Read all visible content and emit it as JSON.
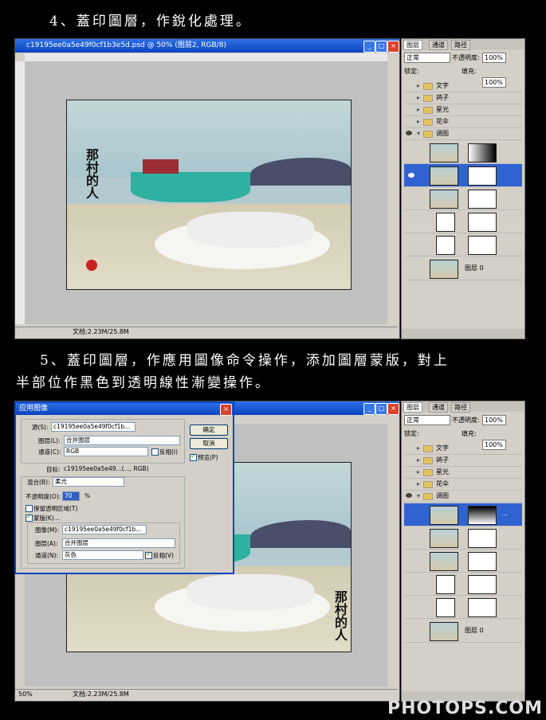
{
  "steps": {
    "step4": "4、蓋印圖層，作銳化處理。",
    "step5_line1": "5、蓋印圖層，作應用圖像命令操作，添加圖層蒙版，對上",
    "step5_line2": "半部位作黑色到透明線性漸變操作。"
  },
  "doc_window": {
    "title": "c19195ee0a5e49f0cf1b3e5d.psd @ 50% (图层2, RGB/8)",
    "status_zoom": "50%",
    "status_doc": "文档:2.23M/25.8M",
    "btn_min": "_",
    "btn_max": "□",
    "btn_close": "×"
  },
  "layers_panel": {
    "tabs": [
      "图层",
      "通道",
      "路径"
    ],
    "blend_mode": "正常",
    "opacity_label": "不透明度:",
    "opacity_value": "100%",
    "lock_label": "锁定:",
    "fill_label": "填充:",
    "fill_value": "100%",
    "groups": [
      "文字",
      "鸽子",
      "星光",
      "花伞",
      "调图"
    ],
    "base_layer": "图层 0",
    "ellipsis": "..."
  },
  "apply_image_dialog": {
    "title": "应用图像",
    "source_label": "源(S):",
    "source_value": "c19195ee0a5e49f0cf1b...",
    "layer_label": "图层(L):",
    "layer_value": "合并图层",
    "channel_label": "通道(C):",
    "channel_value": "RGB",
    "invert_label": "反相(I)",
    "target_label": "目标:",
    "target_value": "c19195ee0a5e49...(..., RGB)",
    "blending_label": "混合(B):",
    "blending_value": "柔光",
    "opacity_label": "不透明度(O):",
    "opacity_value": "70",
    "opacity_unit": "%",
    "preserve_label": "保留透明区域(T)",
    "mask_label": "蒙版(K)...",
    "image_label": "图像(M):",
    "image_value": "c19195ee0a5e49f0cf1b...",
    "mlayer_label": "图层(A):",
    "mlayer_value": "合并图层",
    "mchannel_label": "通道(N):",
    "mchannel_value": "灰色",
    "minvert_label": "反相(V)",
    "ok_label": "确定",
    "cancel_label": "取消",
    "preview_label": "预览(P)"
  },
  "photo": {
    "calligraphy": "那村的人"
  },
  "watermark": "PHOTOPS.COM"
}
